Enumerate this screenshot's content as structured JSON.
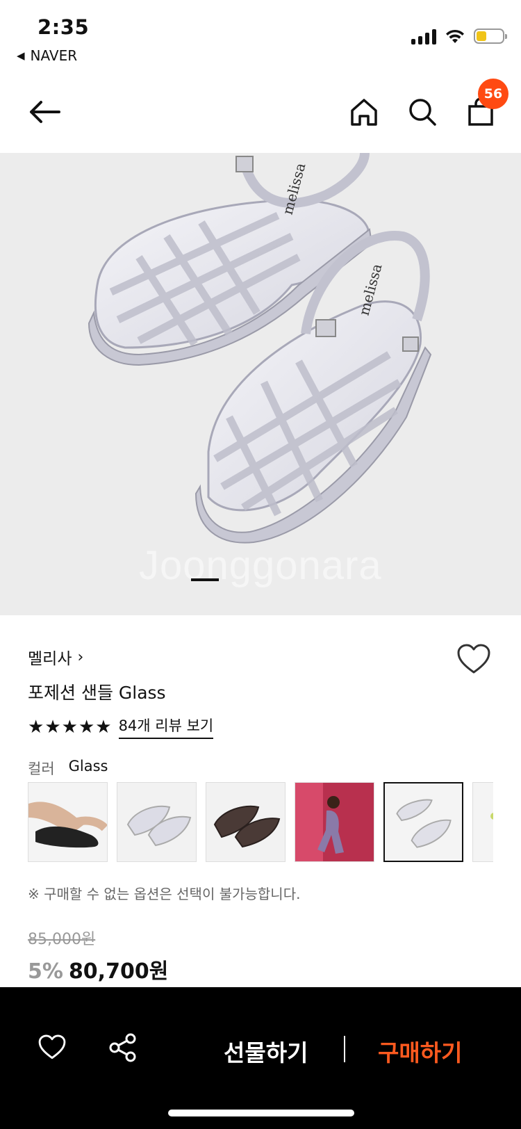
{
  "status_bar": {
    "time": "2:35",
    "back_app": "NAVER",
    "back_icon": "back-triangle-icon",
    "battery_color": "#f0c419"
  },
  "header": {
    "cart_badge": "56",
    "badge_color": "#ff4a12"
  },
  "product": {
    "brand": "멜리사",
    "brand_chevron": "›",
    "name": "포제션 샌들 Glass",
    "rating_stars": 5,
    "review_link": "84개 리뷰 보기",
    "color_label": "컬러",
    "color_value": "Glass",
    "swatches": [
      {
        "name": "black-sandal-on-foot"
      },
      {
        "name": "glass-sandals"
      },
      {
        "name": "brown-sandals"
      },
      {
        "name": "model-photo"
      },
      {
        "name": "glass-sandals-selected",
        "selected": true
      },
      {
        "name": "partial-swatch"
      }
    ],
    "notice": "※ 구매할 수 없는 옵션은 선택이 불가능합니다.",
    "original_price": "85,000원",
    "discount": "5%",
    "price": "80,700원"
  },
  "hero": {
    "watermark": "Joonggonara",
    "page_index": 1
  },
  "bottom_bar": {
    "gift_label": "선물하기",
    "buy_label": "구매하기",
    "buy_color": "#ff5a1f"
  }
}
